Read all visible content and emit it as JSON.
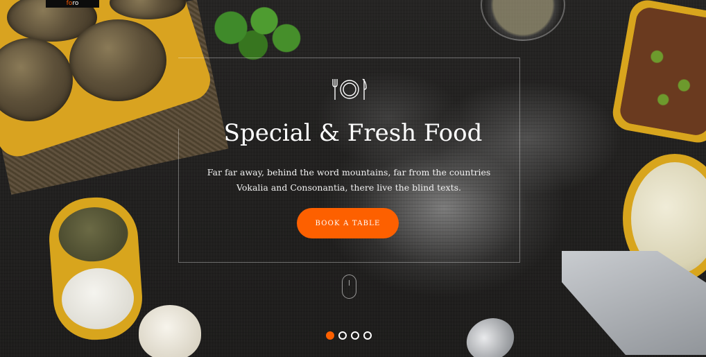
{
  "brand": {
    "logo_text_accent": "fo",
    "logo_text_rest": "ro"
  },
  "hero": {
    "icon": "cutlery-plate-icon",
    "title": "Special & Fresh Food",
    "lead": "Far far away, behind the word mountains, far from the countries Vokalia and Consonantia, there live the blind texts.",
    "cta_label": "BOOK A TABLE",
    "scroll_icon": "mouse-scroll-icon"
  },
  "slider": {
    "count": 4,
    "active_index": 0
  },
  "colors": {
    "accent": "#fd6000",
    "text": "#ffffff",
    "background": "#1f1e1d"
  }
}
